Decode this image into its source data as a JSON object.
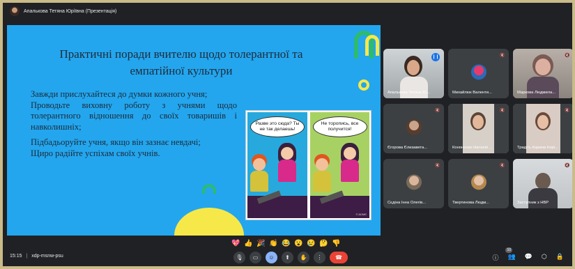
{
  "window": {
    "presenter_label": "Апалькова Тетяна Юріївна (Презентація)"
  },
  "slide": {
    "title": "Практичні поради вчителю щодо толерантної та емпатійної культури",
    "paragraphs": [
      "Завжди прислухайтеся до думки кожного учня;",
      "Проводьте виховну роботу з учнями щодо толерантного відношення до своїх товаришів і навколишніх;",
      "Підбадьоруйте учня, якщо він зазнає невдачі;",
      "Щиро радійте успіхам своїх учнів."
    ],
    "comic": {
      "left_bubble": "Разве это сюда? Ты не так делаешь!",
      "right_bubble": "Не торопись, все получится!",
      "watermark": "© ADME"
    }
  },
  "participants": [
    {
      "name": "Апалькова Тетяна Ю...",
      "type": "video",
      "speaking": true
    },
    {
      "name": "Михайлюк Валенти...",
      "type": "avatar",
      "muted": true
    },
    {
      "name": "Маркова Людмила...",
      "type": "video",
      "muted": true
    },
    {
      "name": "Єгорова Єлизавета...",
      "type": "avatar",
      "muted": true
    },
    {
      "name": "Кононенко Наталія ...",
      "type": "video",
      "muted": true
    },
    {
      "name": "Тридіть Карина Ігорі...",
      "type": "video",
      "muted": true
    },
    {
      "name": "Сєдіна Інна Олегів...",
      "type": "avatar",
      "muted": true
    },
    {
      "name": "Твертинова Людм...",
      "type": "avatar",
      "muted": true
    },
    {
      "name": "Заступник з НВР",
      "type": "video",
      "muted": true
    }
  ],
  "reactions": [
    "💖",
    "👍",
    "🎉",
    "👏",
    "😂",
    "😮",
    "😢",
    "🤔",
    "👎"
  ],
  "bottombar": {
    "time": "15:15",
    "meeting_code": "xdp-msnw-psu",
    "participants_count": "10"
  },
  "colors": {
    "slide_bg": "#23a6ee",
    "hangup": "#ea4335",
    "accent": "#1a73e8"
  }
}
